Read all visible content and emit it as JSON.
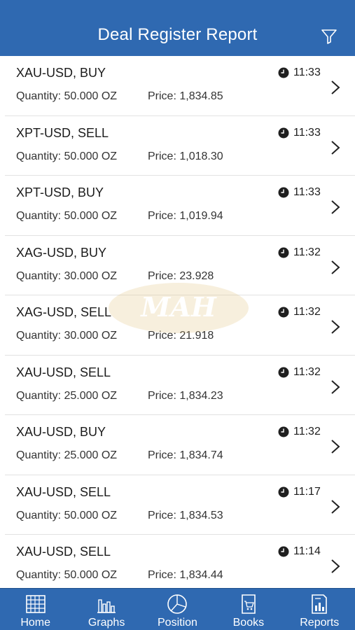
{
  "header": {
    "title": "Deal Register Report",
    "filter_icon": "filter-icon"
  },
  "watermark": {
    "text": "MAH"
  },
  "deals": [
    {
      "deal": "XAU-USD,  BUY",
      "quantity": "Quantity:  50.000 OZ",
      "price": "Price:  1,834.85",
      "time": "11:33"
    },
    {
      "deal": "XPT-USD,  SELL",
      "quantity": "Quantity:  50.000 OZ",
      "price": "Price:  1,018.30",
      "time": "11:33"
    },
    {
      "deal": "XPT-USD,  BUY",
      "quantity": "Quantity:  50.000 OZ",
      "price": "Price:  1,019.94",
      "time": "11:33"
    },
    {
      "deal": "XAG-USD,  BUY",
      "quantity": "Quantity:  30.000 OZ",
      "price": "Price:  23.928",
      "time": "11:32"
    },
    {
      "deal": "XAG-USD,  SELL",
      "quantity": "Quantity:  30.000 OZ",
      "price": "Price:  21.918",
      "time": "11:32"
    },
    {
      "deal": "XAU-USD,  SELL",
      "quantity": "Quantity:  25.000 OZ",
      "price": "Price:  1,834.23",
      "time": "11:32"
    },
    {
      "deal": "XAU-USD,  BUY",
      "quantity": "Quantity:  25.000 OZ",
      "price": "Price:  1,834.74",
      "time": "11:32"
    },
    {
      "deal": "XAU-USD,  SELL",
      "quantity": "Quantity:  50.000 OZ",
      "price": "Price:  1,834.53",
      "time": "11:17"
    },
    {
      "deal": "XAU-USD,  SELL",
      "quantity": "Quantity:  50.000 OZ",
      "price": "Price:  1,834.44",
      "time": "11:14"
    }
  ],
  "tabs": [
    {
      "label": "Home",
      "icon": "calendar-grid-icon"
    },
    {
      "label": "Graphs",
      "icon": "bar-chart-icon"
    },
    {
      "label": "Position",
      "icon": "pie-chart-icon"
    },
    {
      "label": "Books",
      "icon": "book-cart-icon"
    },
    {
      "label": "Reports",
      "icon": "report-document-icon"
    }
  ],
  "colors": {
    "primary": "#2f69b1",
    "divider": "#e2e2e2"
  }
}
